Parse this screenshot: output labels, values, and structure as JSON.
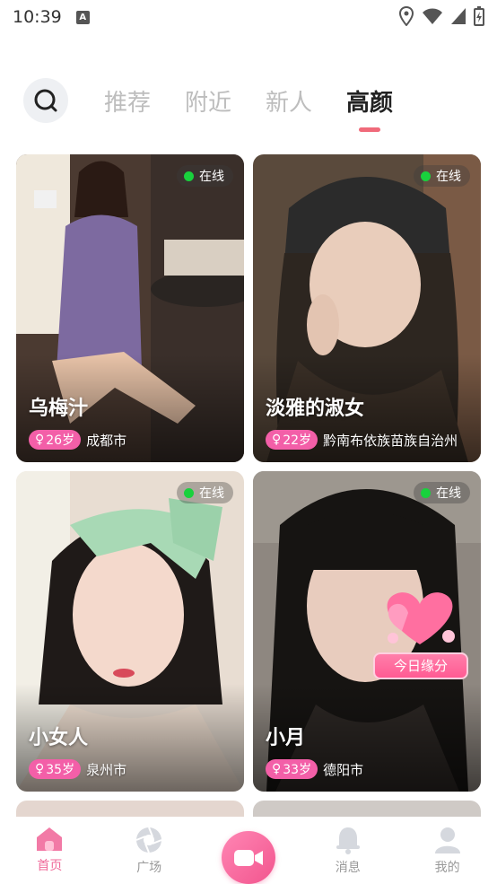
{
  "status_bar": {
    "time": "10:39",
    "notification_icon": "A"
  },
  "tabs": {
    "search_icon": "search-icon",
    "items": [
      {
        "label": "推荐",
        "active": false
      },
      {
        "label": "附近",
        "active": false
      },
      {
        "label": "新人",
        "active": false
      },
      {
        "label": "高颜",
        "active": true
      }
    ]
  },
  "cards": [
    {
      "name": "乌梅汁",
      "age": "26岁",
      "city": "成都市",
      "online": "在线"
    },
    {
      "name": "淡雅的淑女",
      "age": "22岁",
      "city": "黔南布依族苗族自治州",
      "online": "在线"
    },
    {
      "name": "小女人",
      "age": "35岁",
      "city": "泉州市",
      "online": "在线"
    },
    {
      "name": "小月",
      "age": "33岁",
      "city": "德阳市",
      "online": "在线",
      "badge": "今日缘分"
    }
  ],
  "bottom_nav": [
    {
      "label": "首页",
      "icon": "home-icon",
      "active": true
    },
    {
      "label": "广场",
      "icon": "aperture-icon",
      "active": false
    },
    {
      "label": "",
      "icon": "video-camera-icon",
      "active": false
    },
    {
      "label": "消息",
      "icon": "bell-icon",
      "active": false
    },
    {
      "label": "我的",
      "icon": "profile-icon",
      "active": false
    }
  ],
  "colors": {
    "accent": "#f06a7a",
    "age_badge": "#f35fa8",
    "online_dot": "#19d13d",
    "nav_active": "#f06a9a"
  }
}
